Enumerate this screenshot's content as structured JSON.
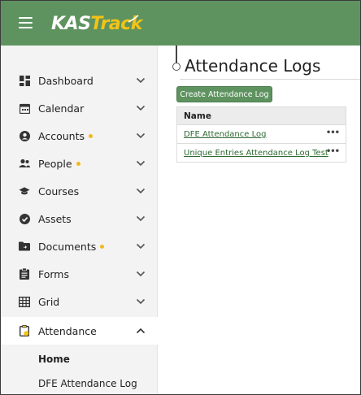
{
  "header": {
    "logo_part1": "KAS",
    "logo_part2": "Track",
    "brand_color": "#5e9360",
    "accent_color": "#f3c316"
  },
  "sidebar": {
    "items": [
      {
        "label": "Dashboard",
        "icon": "dashboard-icon",
        "dot": false,
        "expanded": false
      },
      {
        "label": "Calendar",
        "icon": "calendar-icon",
        "dot": false,
        "expanded": false
      },
      {
        "label": "Accounts",
        "icon": "account-icon",
        "dot": true,
        "expanded": false
      },
      {
        "label": "People",
        "icon": "people-icon",
        "dot": true,
        "expanded": false
      },
      {
        "label": "Courses",
        "icon": "graduation-cap-icon",
        "dot": false,
        "expanded": false
      },
      {
        "label": "Assets",
        "icon": "check-circle-icon",
        "dot": false,
        "expanded": false
      },
      {
        "label": "Documents",
        "icon": "folder-icon",
        "dot": true,
        "expanded": false
      },
      {
        "label": "Forms",
        "icon": "clipboard-icon",
        "dot": false,
        "expanded": false
      },
      {
        "label": "Grid",
        "icon": "grid-icon",
        "dot": false,
        "expanded": false
      },
      {
        "label": "Attendance",
        "icon": "attendance-icon",
        "dot": false,
        "expanded": true
      }
    ],
    "sub_items": [
      {
        "label": "Home",
        "bold": true
      },
      {
        "label": "DFE Attendance Log",
        "bold": false
      }
    ]
  },
  "main": {
    "title": "Attendance Logs",
    "create_button": "Create Attendance Log",
    "table": {
      "header": "Name",
      "rows": [
        {
          "name": "DFE Attendance Log",
          "more": "•••"
        },
        {
          "name": "Unique Entries Attendance Log Test",
          "more": "•••"
        }
      ]
    }
  }
}
